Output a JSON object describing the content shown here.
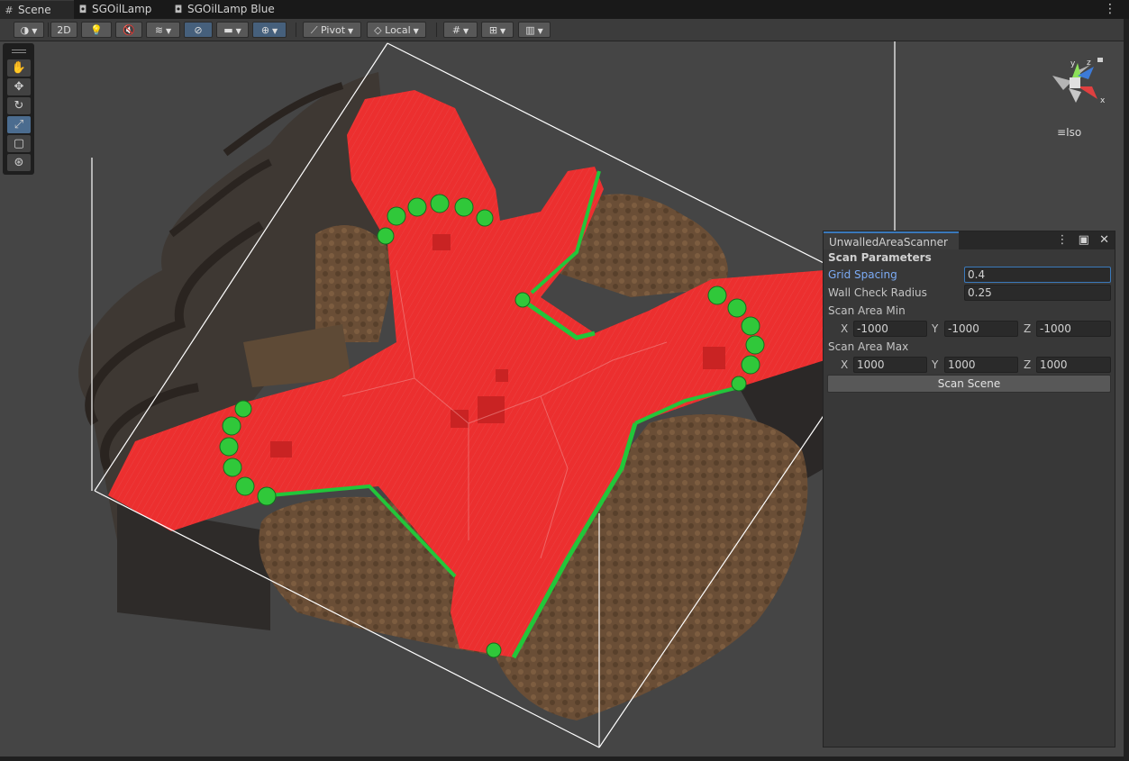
{
  "tabs": [
    {
      "label": "Scene",
      "icon": "grid-icon"
    },
    {
      "label": "SGOilLamp",
      "icon": "prefab-icon"
    },
    {
      "label": "SGOilLamp Blue",
      "icon": "prefab-icon"
    }
  ],
  "toolbar": {
    "two_d_label": "2D",
    "pivot_label": "Pivot",
    "local_label": "Local"
  },
  "gizmo": {
    "axis_y": "y",
    "axis_z": "z",
    "axis_x": "x",
    "projection_label": "Iso"
  },
  "inspector": {
    "tab_title": "UnwalledAreaScanner",
    "section_header": "Scan Parameters",
    "grid_spacing": {
      "label": "Grid Spacing",
      "value": "0.4"
    },
    "wall_check_radius": {
      "label": "Wall Check Radius",
      "value": "0.25"
    },
    "scan_area_min": {
      "label": "Scan Area Min",
      "x_label": "X",
      "x": "-1000",
      "y_label": "Y",
      "y": "-1000",
      "z_label": "Z",
      "z": "-1000"
    },
    "scan_area_max": {
      "label": "Scan Area Max",
      "x_label": "X",
      "x": "1000",
      "y_label": "Y",
      "y": "1000",
      "z_label": "Z",
      "z": "1000"
    },
    "scan_button_label": "Scan Scene"
  }
}
